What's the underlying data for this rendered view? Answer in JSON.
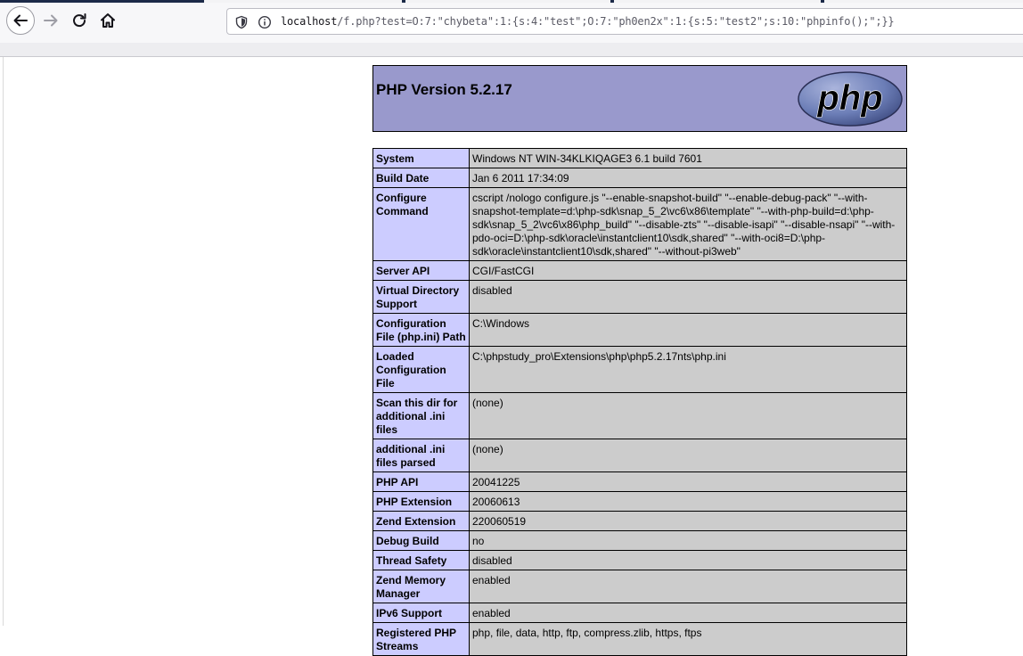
{
  "browser": {
    "url": {
      "host": "localhost",
      "path": "/f.php?test=O:7:\"chybeta\":1:{s:4:\"test\";O:7:\"ph0en2x\":1:{s:5:\"test2\";s:10:\"phpinfo();\";}}"
    }
  },
  "phpinfo": {
    "title": "PHP Version 5.2.17",
    "logo_text": "php",
    "rows": [
      {
        "name": "System",
        "value": "Windows NT WIN-34KLKIQAGE3 6.1 build 7601"
      },
      {
        "name": "Build Date",
        "value": "Jan 6 2011 17:34:09"
      },
      {
        "name": "Configure Command",
        "value": "cscript /nologo configure.js \"--enable-snapshot-build\" \"--enable-debug-pack\" \"--with-snapshot-template=d:\\php-sdk\\snap_5_2\\vc6\\x86\\template\" \"--with-php-build=d:\\php-sdk\\snap_5_2\\vc6\\x86\\php_build\" \"--disable-zts\" \"--disable-isapi\" \"--disable-nsapi\" \"--with-pdo-oci=D:\\php-sdk\\oracle\\instantclient10\\sdk,shared\" \"--with-oci8=D:\\php-sdk\\oracle\\instantclient10\\sdk,shared\" \"--without-pi3web\""
      },
      {
        "name": "Server API",
        "value": "CGI/FastCGI"
      },
      {
        "name": "Virtual Directory Support",
        "value": "disabled"
      },
      {
        "name": "Configuration File (php.ini) Path",
        "value": "C:\\Windows"
      },
      {
        "name": "Loaded Configuration File",
        "value": "C:\\phpstudy_pro\\Extensions\\php\\php5.2.17nts\\php.ini"
      },
      {
        "name": "Scan this dir for additional .ini files",
        "value": "(none)"
      },
      {
        "name": "additional .ini files parsed",
        "value": "(none)"
      },
      {
        "name": "PHP API",
        "value": "20041225"
      },
      {
        "name": "PHP Extension",
        "value": "20060613"
      },
      {
        "name": "Zend Extension",
        "value": "220060519"
      },
      {
        "name": "Debug Build",
        "value": "no"
      },
      {
        "name": "Thread Safety",
        "value": "disabled"
      },
      {
        "name": "Zend Memory Manager",
        "value": "enabled"
      },
      {
        "name": "IPv6 Support",
        "value": "enabled"
      },
      {
        "name": "Registered PHP Streams",
        "value": "php, file, data, http, ftp, compress.zlib, https, ftps"
      }
    ]
  },
  "icons": {
    "back": "back-arrow-icon",
    "forward": "forward-arrow-icon",
    "reload": "reload-icon",
    "home": "home-icon",
    "tracking": "tracking-shield-icon",
    "info": "site-info-icon"
  },
  "colors": {
    "header_bg": "#9999cc",
    "label_bg": "#ccccff",
    "value_bg": "#cccccc",
    "logo_blue": "#6c7eb7"
  }
}
